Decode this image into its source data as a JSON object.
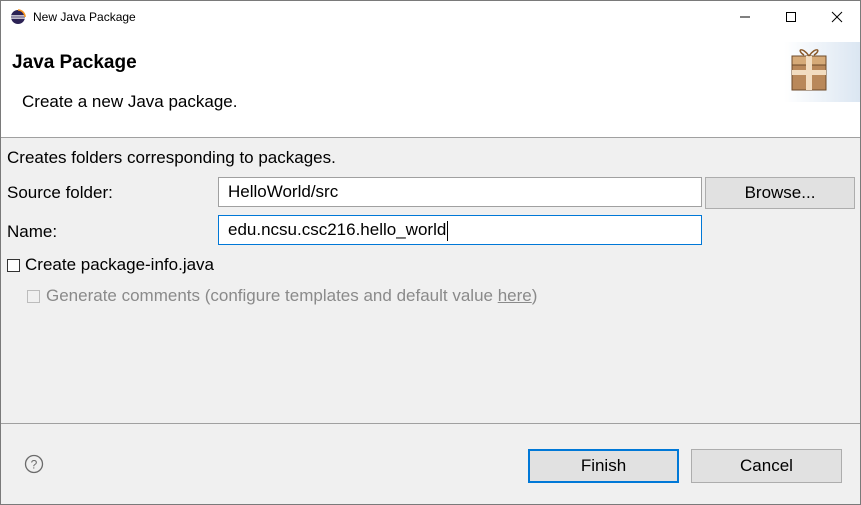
{
  "window": {
    "title": "New Java Package",
    "icons": {
      "app": "eclipse-icon",
      "minimize": "minimize-icon",
      "maximize": "maximize-icon",
      "close": "close-icon"
    }
  },
  "banner": {
    "title": "Java Package",
    "description": "Create a new Java package.",
    "image": "package-icon"
  },
  "form": {
    "info": "Creates folders corresponding to packages.",
    "source_folder_label": "Source folder:",
    "source_folder_value": "HelloWorld/src",
    "browse_label": "Browse...",
    "name_label": "Name:",
    "name_value": "edu.ncsu.csc216.hello_world",
    "create_package_info_label": "Create package-info.java",
    "create_package_info_checked": false,
    "generate_comments_prefix": "Generate comments (configure templates and default value ",
    "generate_comments_link": "here",
    "generate_comments_suffix": ")",
    "generate_comments_enabled": false
  },
  "footer": {
    "help_icon": "help-icon",
    "finish_label": "Finish",
    "cancel_label": "Cancel"
  },
  "colors": {
    "focus": "#0078d7",
    "disabled_text": "#8a8a8a",
    "dialog_bg": "#f0f0f0"
  }
}
